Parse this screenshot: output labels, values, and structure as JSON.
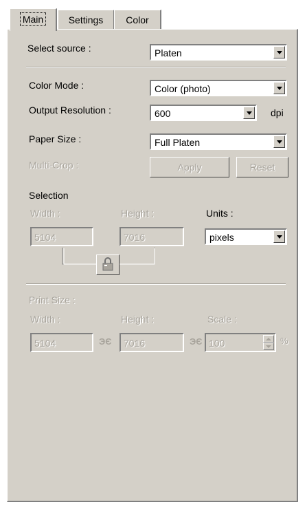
{
  "tabs": [
    {
      "label": "Main"
    },
    {
      "label": "Settings"
    },
    {
      "label": "Color"
    }
  ],
  "source": {
    "label": "Select source :",
    "value": "Platen"
  },
  "color_mode": {
    "label": "Color Mode :",
    "value": "Color (photo)"
  },
  "resolution": {
    "label": "Output Resolution :",
    "value": "600",
    "unit": "dpi"
  },
  "paper_size": {
    "label": "Paper Size :",
    "value": "Full Platen"
  },
  "multi_crop": {
    "label": "Multi-Crop :",
    "apply": "Apply",
    "reset": "Reset"
  },
  "selection": {
    "title": "Selection",
    "width_label": "Width :",
    "width_value": "5104",
    "height_label": "Height :",
    "height_value": "7016",
    "units_label": "Units :",
    "units_value": "pixels"
  },
  "print_size": {
    "title": "Print Size :",
    "width_label": "Width :",
    "width_value": "5104",
    "height_label": "Height :",
    "height_value": "7016",
    "scale_label": "Scale :",
    "scale_value": "100",
    "percent": "%"
  },
  "icons": {
    "link": "link-icon",
    "lock": "proportion-lock-icon"
  },
  "colors": {
    "face": "#d4d0c8",
    "disabled": "#a8a49c"
  }
}
